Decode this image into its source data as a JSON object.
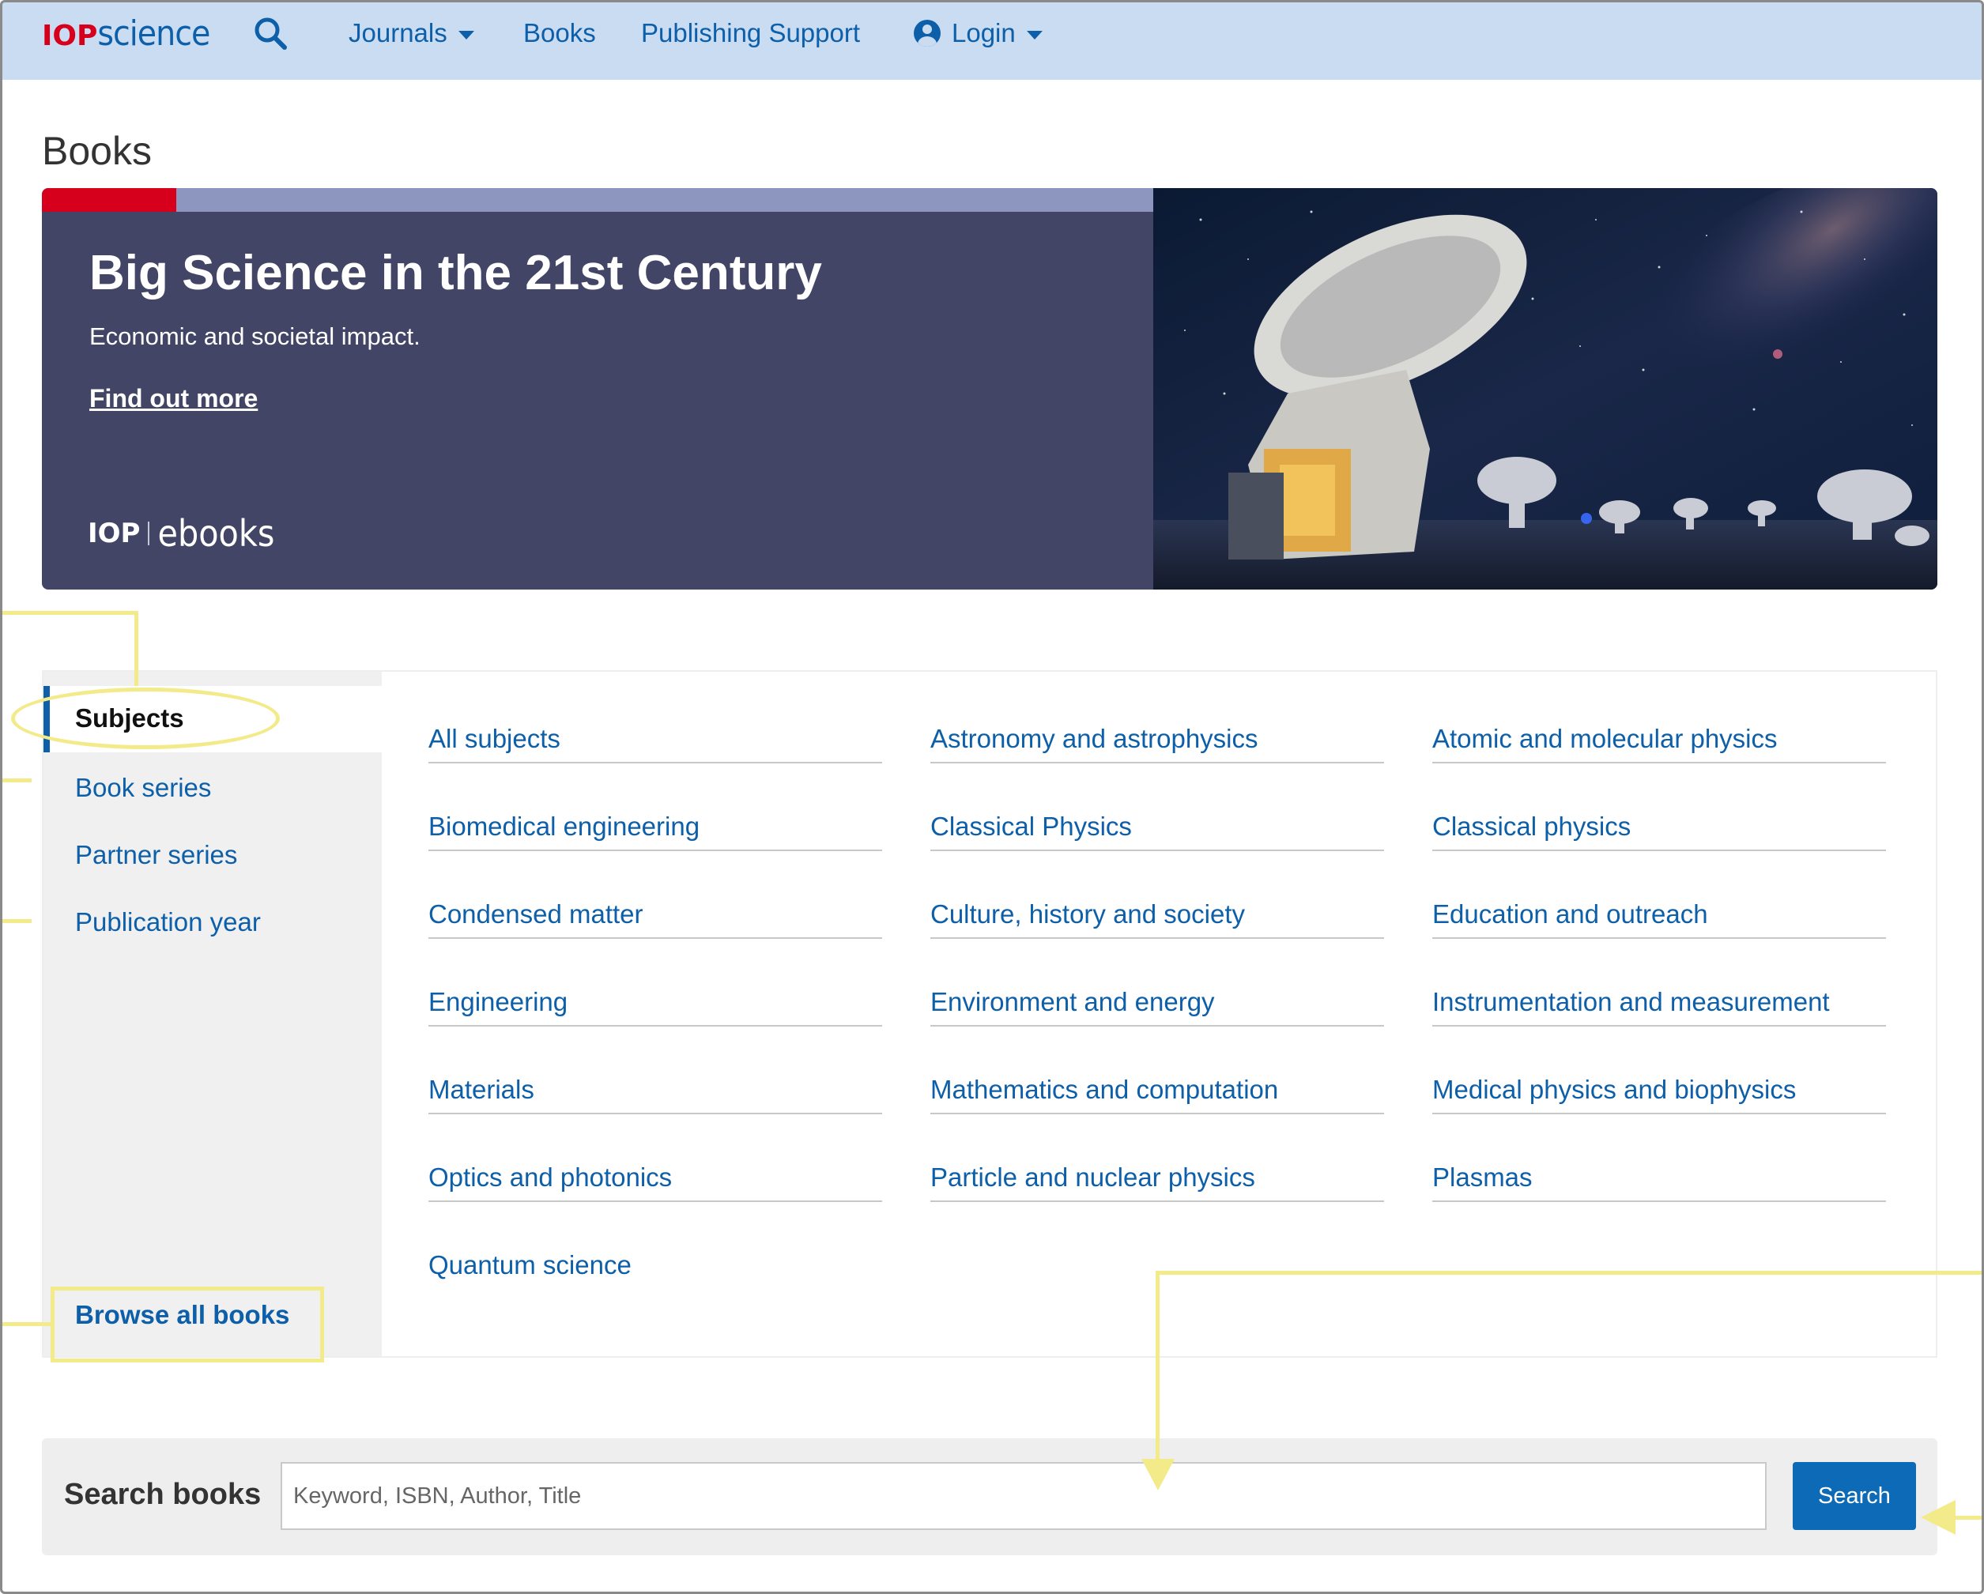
{
  "nav": {
    "logo_part1": "IOP",
    "logo_part2": "science",
    "items": [
      {
        "label": "Journals"
      },
      {
        "label": "Books"
      },
      {
        "label": "Publishing Support"
      },
      {
        "label": "Login"
      }
    ],
    "icons": [
      "search-icon",
      "chevron-down-icon",
      "user-icon"
    ]
  },
  "page": {
    "title": "Books"
  },
  "banner": {
    "title": "Big Science in the 21st Century",
    "subtitle": "Economic and societal impact.",
    "link": "Find out more",
    "brand_part1": "IOP",
    "brand_part2": "ebooks",
    "image": "radio-telescope-night-sky"
  },
  "sidebar": {
    "active": "Subjects",
    "items": [
      "Book series",
      "Partner series",
      "Publication year"
    ],
    "browse_all": "Browse all books"
  },
  "subjects": [
    "All subjects",
    "Astronomy and astrophysics",
    "Atomic and molecular physics",
    "Biomedical engineering",
    "Classical Physics",
    "Classical physics",
    "Condensed matter",
    "Culture, history and society",
    "Education and outreach",
    "Engineering",
    "Environment and energy",
    "Instrumentation and measurement",
    "Materials",
    "Mathematics and computation",
    "Medical physics and biophysics",
    "Optics and photonics",
    "Particle and nuclear physics",
    "Plasmas",
    "Quantum science"
  ],
  "search": {
    "label": "Search books",
    "placeholder": "Keyword, ISBN, Author, Title",
    "button": "Search"
  },
  "colors": {
    "nav_bg": "#cadcf2",
    "link": "#0c5fa8",
    "brand_red": "#d6001c",
    "banner_bg": "#424566",
    "annotation": "#f3ea8a"
  }
}
